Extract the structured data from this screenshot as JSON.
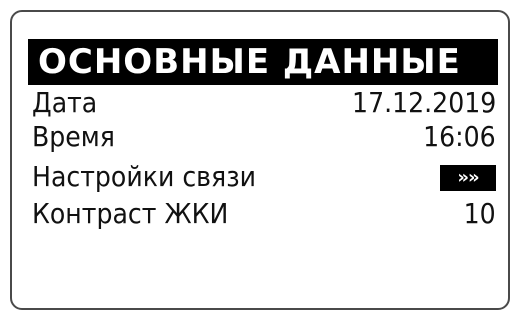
{
  "screen": {
    "title": "ОСНОВНЫЕ ДАННЫЕ",
    "rows": [
      {
        "label": "Дата",
        "value": "17.12.2019"
      },
      {
        "label": "Время",
        "value": "16:06"
      },
      {
        "label": "Настройки связи",
        "value": "»»"
      },
      {
        "label": "Контраст ЖКИ",
        "value": "10"
      }
    ]
  }
}
